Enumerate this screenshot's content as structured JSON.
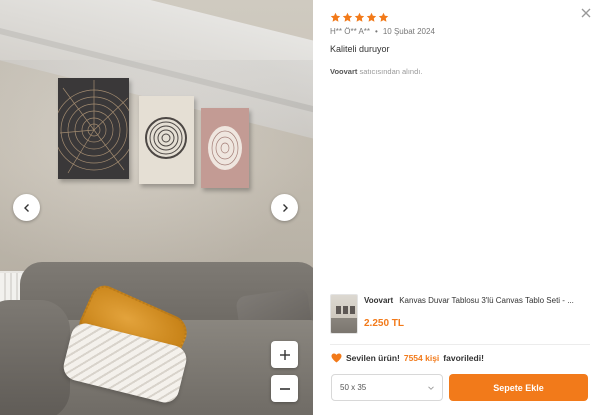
{
  "review": {
    "rating": 5,
    "author": "H** Ö** A**",
    "separator": "•",
    "date": "10 Şubat 2024",
    "comment": "Kaliteli duruyor",
    "seller_name": "Voovart",
    "seller_suffix": "satıcısından alındı."
  },
  "gallery": {
    "prev_icon": "chevron-left-icon",
    "next_icon": "chevron-right-icon",
    "zoom_in_icon": "plus-icon",
    "zoom_out_icon": "minus-icon"
  },
  "product": {
    "brand": "Voovart",
    "title": "Kanvas Duvar Tablosu 3'lü Canvas Tablo Seti - ...",
    "price": "2.250 TL"
  },
  "favorites": {
    "prefix": "Sevilen ürün!",
    "count": "7554 kişi",
    "suffix": "favoriledi!"
  },
  "variant": {
    "selected": "50 x 35"
  },
  "actions": {
    "add_to_cart": "Sepete Ekle",
    "close_icon": "close-icon"
  },
  "colors": {
    "accent": "#f27a1a",
    "star": "#f27a1a"
  }
}
